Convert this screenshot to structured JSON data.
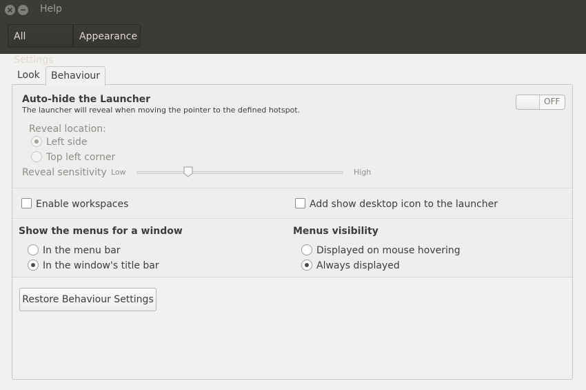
{
  "window": {
    "title": "Help"
  },
  "toolbar": {
    "all_settings": "All Settings",
    "appearance": "Appearance"
  },
  "tabs": [
    {
      "label": "Look"
    },
    {
      "label": "Behaviour"
    }
  ],
  "autohide": {
    "title": "Auto-hide the Launcher",
    "description": "The launcher will reveal when moving the pointer to the defined hotspot.",
    "toggle_state": "OFF",
    "reveal_location_label": "Reveal location:",
    "options": [
      "Left side",
      "Top left corner"
    ],
    "selected": "Left side",
    "sensitivity_label": "Reveal sensitivity",
    "slider_low": "Low",
    "slider_high": "High",
    "slider_value": 0.25
  },
  "workspaces": {
    "enable_workspaces": "Enable workspaces",
    "show_desktop_icon": "Add show desktop icon to the launcher"
  },
  "menus": {
    "show_menus_title": "Show the menus for a window",
    "show_menus_options": [
      "In the menu bar",
      "In the window's title bar"
    ],
    "show_menus_selected": "In the window's title bar",
    "visibility_title": "Menus visibility",
    "visibility_options": [
      "Displayed on mouse hovering",
      "Always displayed"
    ],
    "visibility_selected": "Always displayed"
  },
  "restore_button": "Restore Behaviour Settings",
  "icons": {
    "close": "close-icon",
    "minimize": "minimize-icon"
  },
  "colors": {
    "titlebar": "#3c3b37",
    "background": "#f2f1f0"
  }
}
